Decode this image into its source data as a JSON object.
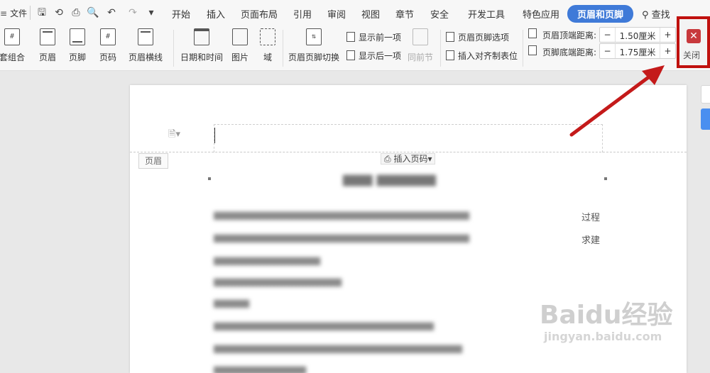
{
  "menubar": {
    "file_label": "文件",
    "tabs": [
      "开始",
      "插入",
      "页面布局",
      "引用",
      "审阅",
      "视图",
      "章节",
      "安全",
      "开发工具",
      "特色应用",
      "页眉和页脚"
    ],
    "active_tab": "页眉和页脚",
    "search_label": "查找",
    "active_color": "#3f7ad8"
  },
  "ribbon": {
    "big_buttons": [
      "套组合",
      "页眉",
      "页脚",
      "页码",
      "页眉横线",
      "日期和时间",
      "图片",
      "域",
      "页眉页脚切换"
    ],
    "show_prev": "显示前一项",
    "show_next": "显示后一项",
    "same_as_prev": "同前节",
    "hf_options": "页眉页脚选项",
    "insert_align_tab": "插入对齐制表位",
    "top_dist_label": "页眉顶端距离:",
    "top_dist_value": "1.50厘米",
    "bottom_dist_label": "页脚底端距离:",
    "bottom_dist_value": "1.75厘米",
    "close_label": "关闭",
    "close_highlight_color": "#c0110e"
  },
  "document": {
    "header_tag": "页眉",
    "insert_page_number": "插入页码",
    "visible_text_1": "过程",
    "visible_text_2": "求建"
  },
  "watermark": {
    "logo": "Baidu经验",
    "url": "jingyan.baidu.com"
  }
}
